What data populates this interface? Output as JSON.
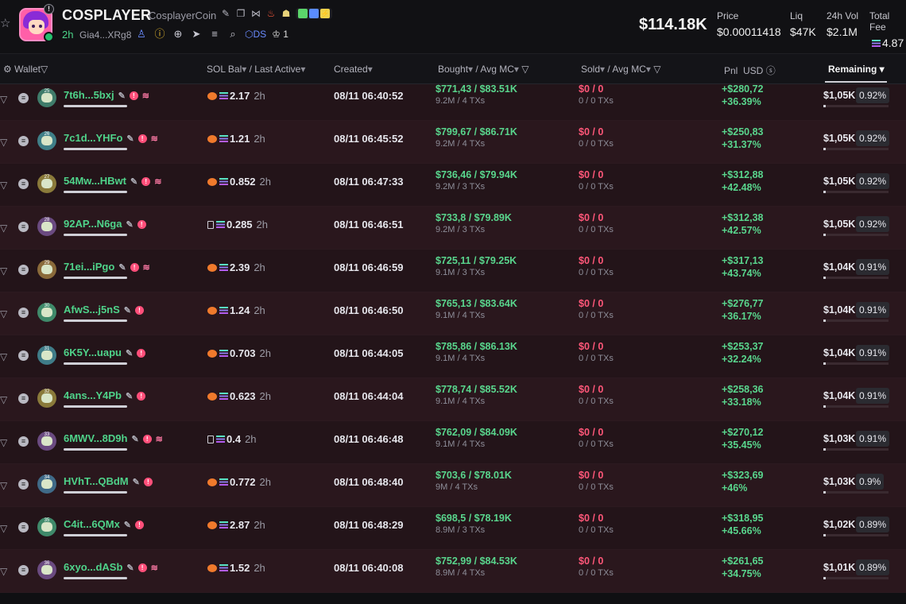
{
  "token": {
    "name": "COSPLAYER",
    "subname": "CosplayerCoin",
    "age": "2h",
    "address": "Gia4...XRg8",
    "ds_label": "DS",
    "holders_count": "1",
    "logo_badge": "!"
  },
  "stats": {
    "market_cap": "$114.18K",
    "price_label": "Price",
    "price_value": "$0.00011418",
    "liq_label": "Liq",
    "liq_value": "$47K",
    "vol_label": "24h Vol",
    "vol_value": "$2.1M",
    "fees_label": "Total Fee",
    "fees_value": "4.87"
  },
  "columns": {
    "wallet": "Wallet",
    "sol_bal": "SOL Bal",
    "last_active": "/ Last Active",
    "created": "Created",
    "bought": "Bought",
    "avg_mc_bought": "/ Avg MC",
    "sold": "Sold",
    "avg_mc_sold": "/ Avg MC",
    "pnl": "Pnl",
    "usd": "USD",
    "remaining": "Remaining"
  },
  "icons": {
    "star": "star-icon",
    "edit": "pencil-icon",
    "copy": "copy-icon",
    "share": "share-icon",
    "fire": "fire-icon",
    "people": "people-icon",
    "user": "user-icon",
    "warning": "warning-icon",
    "globe": "globe-icon",
    "telegram": "telegram-icon",
    "list": "list-icon",
    "search": "search-icon",
    "filter": "filter-icon",
    "alert": "alert-icon",
    "layers": "layers-icon",
    "sol": "solana-icon"
  },
  "colors": {
    "accent_green": "#59d68d",
    "accent_red": "#ff5779",
    "row_bg": "#231419"
  },
  "rows": [
    {
      "name": "7t6h...5bxj",
      "layers": true,
      "src": "orange",
      "sol": "2.17",
      "ago": "2h",
      "created": "08/11 06:40:52",
      "bought": "$771,43 / $83.51K",
      "bought_sub": "9.2M / 4 TXs",
      "sold": "$0 / 0",
      "sold_sub": "0 / 0 TXs",
      "pnl": "+$280,72",
      "pnl_pct": "+36.39%",
      "remaining": "$1,05K",
      "rem_pct": "0.92%",
      "avatar_no": "25",
      "avatar_color": "#3f7c6a"
    },
    {
      "name": "7c1d...YHFo",
      "layers": true,
      "src": "orange",
      "sol": "1.21",
      "ago": "2h",
      "created": "08/11 06:45:52",
      "bought": "$799,67 / $86.71K",
      "bought_sub": "9.2M / 4 TXs",
      "sold": "$0 / 0",
      "sold_sub": "0 / 0 TXs",
      "pnl": "+$250,83",
      "pnl_pct": "+31.37%",
      "remaining": "$1,05K",
      "rem_pct": "0.92%",
      "avatar_no": "26",
      "avatar_color": "#3f7f88"
    },
    {
      "name": "54Mw...HBwt",
      "layers": true,
      "src": "orange",
      "sol": "0.852",
      "ago": "2h",
      "created": "08/11 06:47:33",
      "bought": "$736,46 / $79.94K",
      "bought_sub": "9.2M / 3 TXs",
      "sold": "$0 / 0",
      "sold_sub": "0 / 0 TXs",
      "pnl": "+$312,88",
      "pnl_pct": "+42.48%",
      "remaining": "$1,05K",
      "rem_pct": "0.92%",
      "avatar_no": "27",
      "avatar_color": "#8a7a3a"
    },
    {
      "name": "92AP...N6ga",
      "layers": false,
      "src": "box",
      "sol": "0.285",
      "ago": "2h",
      "created": "08/11 06:46:51",
      "bought": "$733,8 / $79.89K",
      "bought_sub": "9.2M / 3 TXs",
      "sold": "$0 / 0",
      "sold_sub": "0 / 0 TXs",
      "pnl": "+$312,38",
      "pnl_pct": "+42.57%",
      "remaining": "$1,05K",
      "rem_pct": "0.92%",
      "avatar_no": "28",
      "avatar_color": "#6a4a80"
    },
    {
      "name": "71ei...iPgo",
      "layers": true,
      "src": "orange",
      "sol": "2.39",
      "ago": "2h",
      "created": "08/11 06:46:59",
      "bought": "$725,11 / $79.25K",
      "bought_sub": "9.1M / 3 TXs",
      "sold": "$0 / 0",
      "sold_sub": "0 / 0 TXs",
      "pnl": "+$317,13",
      "pnl_pct": "+43.74%",
      "remaining": "$1,04K",
      "rem_pct": "0.91%",
      "avatar_no": "29",
      "avatar_color": "#8a6a3a"
    },
    {
      "name": "AfwS...j5nS",
      "layers": false,
      "src": "orange",
      "sol": "1.24",
      "ago": "2h",
      "created": "08/11 06:46:50",
      "bought": "$765,13 / $83.64K",
      "bought_sub": "9.1M / 4 TXs",
      "sold": "$0 / 0",
      "sold_sub": "0 / 0 TXs",
      "pnl": "+$276,77",
      "pnl_pct": "+36.17%",
      "remaining": "$1,04K",
      "rem_pct": "0.91%",
      "avatar_no": "30",
      "avatar_color": "#3f8a6a"
    },
    {
      "name": "6K5Y...uapu",
      "layers": false,
      "src": "orange",
      "sol": "0.703",
      "ago": "2h",
      "created": "08/11 06:44:05",
      "bought": "$785,86 / $86.13K",
      "bought_sub": "9.1M / 4 TXs",
      "sold": "$0 / 0",
      "sold_sub": "0 / 0 TXs",
      "pnl": "+$253,37",
      "pnl_pct": "+32.24%",
      "remaining": "$1,04K",
      "rem_pct": "0.91%",
      "avatar_no": "31",
      "avatar_color": "#3f7c88"
    },
    {
      "name": "4ans...Y4Pb",
      "layers": false,
      "src": "orange",
      "sol": "0.623",
      "ago": "2h",
      "created": "08/11 06:44:04",
      "bought": "$778,74 / $85.52K",
      "bought_sub": "9.1M / 4 TXs",
      "sold": "$0 / 0",
      "sold_sub": "0 / 0 TXs",
      "pnl": "+$258,36",
      "pnl_pct": "+33.18%",
      "remaining": "$1,04K",
      "rem_pct": "0.91%",
      "avatar_no": "32",
      "avatar_color": "#8a7a3a"
    },
    {
      "name": "6MWV...8D9h",
      "layers": true,
      "src": "box",
      "sol": "0.4",
      "ago": "2h",
      "created": "08/11 06:46:48",
      "bought": "$762,09 / $84.09K",
      "bought_sub": "9.1M / 4 TXs",
      "sold": "$0 / 0",
      "sold_sub": "0 / 0 TXs",
      "pnl": "+$270,12",
      "pnl_pct": "+35.45%",
      "remaining": "$1,03K",
      "rem_pct": "0.91%",
      "avatar_no": "33",
      "avatar_color": "#6a4a80"
    },
    {
      "name": "HVhT...QBdM",
      "layers": false,
      "src": "orange",
      "sol": "0.772",
      "ago": "2h",
      "created": "08/11 06:48:40",
      "bought": "$703,6 / $78.01K",
      "bought_sub": "9M / 4 TXs",
      "sold": "$0 / 0",
      "sold_sub": "0 / 0 TXs",
      "pnl": "+$323,69",
      "pnl_pct": "+46%",
      "remaining": "$1,03K",
      "rem_pct": "0.9%",
      "avatar_no": "34",
      "avatar_color": "#3f6a88"
    },
    {
      "name": "C4it...6QMx",
      "layers": false,
      "src": "orange",
      "sol": "2.87",
      "ago": "2h",
      "created": "08/11 06:48:29",
      "bought": "$698,5 / $78.19K",
      "bought_sub": "8.9M / 3 TXs",
      "sold": "$0 / 0",
      "sold_sub": "0 / 0 TXs",
      "pnl": "+$318,95",
      "pnl_pct": "+45.66%",
      "remaining": "$1,02K",
      "rem_pct": "0.89%",
      "avatar_no": "35",
      "avatar_color": "#3f8a6a"
    },
    {
      "name": "6xyo...dASb",
      "layers": true,
      "src": "orange",
      "sol": "1.52",
      "ago": "2h",
      "created": "08/11 06:40:08",
      "bought": "$752,99 / $84.53K",
      "bought_sub": "8.9M / 4 TXs",
      "sold": "$0 / 0",
      "sold_sub": "0 / 0 TXs",
      "pnl": "+$261,65",
      "pnl_pct": "+34.75%",
      "remaining": "$1,01K",
      "rem_pct": "0.89%",
      "avatar_no": "36",
      "avatar_color": "#6a4a80"
    }
  ]
}
